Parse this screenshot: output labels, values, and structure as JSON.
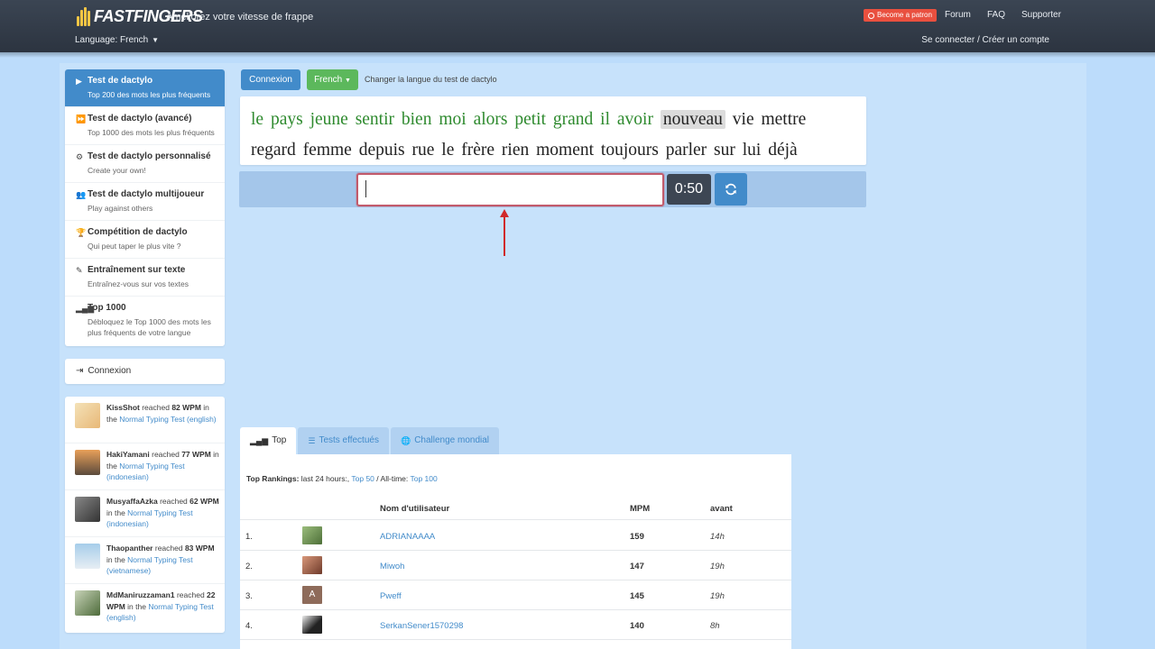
{
  "header": {
    "logo_text": "FASTFINGERS",
    "logo_prefix": "10",
    "tagline": "Améliorez votre vitesse de frappe",
    "patron_label": "Become a patron",
    "nav": {
      "forum": "Forum",
      "faq": "FAQ",
      "support": "Supporter"
    },
    "language_label": "Language: French",
    "login_link": "Se connecter / Créer un compte"
  },
  "sidebar": {
    "items": [
      {
        "title": "Test de dactylo",
        "sub": "Top 200 des mots les plus fréquents",
        "icon": "play-icon"
      },
      {
        "title": "Test de dactylo (avancé)",
        "sub": "Top 1000 des mots les plus fréquents",
        "icon": "fast-forward-icon"
      },
      {
        "title": "Test de dactylo personnalisé",
        "sub": "Create your own!",
        "icon": "cogs-icon"
      },
      {
        "title": "Test de dactylo multijoueur",
        "sub": "Play against others",
        "icon": "users-icon"
      },
      {
        "title": "Compétition de dactylo",
        "sub": "Qui peut taper le plus vite ?",
        "icon": "trophy-icon"
      },
      {
        "title": "Entraînement sur texte",
        "sub": "Entraînez-vous sur vos textes",
        "icon": "edit-icon"
      },
      {
        "title": "Top 1000",
        "sub": "Débloquez le Top 1000 des mots les plus fréquents de votre langue",
        "icon": "signal-icon"
      }
    ],
    "login": "Connexion"
  },
  "activity": [
    {
      "user": "KissShot",
      "reached": "reached",
      "wpm": "82 WPM",
      "in": "in the",
      "test": "Normal Typing Test",
      "lang": "(english)"
    },
    {
      "user": "HakiYamani",
      "reached": "reached",
      "wpm": "77 WPM",
      "in": "in the",
      "test": "Normal Typing Test",
      "lang": "(indonesian)"
    },
    {
      "user": "MusyaffaAzka",
      "reached": "reached",
      "wpm": "62 WPM",
      "in": "in the",
      "test": "Normal Typing Test",
      "lang": "(indonesian)"
    },
    {
      "user": "Thaopanther",
      "reached": "reached",
      "wpm": "83 WPM",
      "in": "in the",
      "test": "Normal Typing Test",
      "lang": "(vietnamese)"
    },
    {
      "user": "MdManiruzzaman1",
      "reached": "reached",
      "wpm": "22 WPM",
      "in": "in the",
      "test": "Normal Typing Test",
      "lang": "(english)"
    }
  ],
  "controls": {
    "connexion": "Connexion",
    "language_button": "French",
    "change_language": "Changer la langue du test de dactylo"
  },
  "words": {
    "done": [
      "le",
      "pays",
      "jeune",
      "sentir",
      "bien",
      "moi",
      "alors",
      "petit",
      "grand",
      "il",
      "avoir"
    ],
    "current": "nouveau",
    "upcoming_line1": [
      "vie",
      "mettre"
    ],
    "line2": [
      "regard",
      "femme",
      "depuis",
      "rue",
      "le",
      "frère",
      "rien",
      "moment",
      "toujours",
      "parler",
      "sur",
      "lui",
      "déjà"
    ]
  },
  "typing": {
    "value": "",
    "timer": "0:50"
  },
  "tabs": {
    "top": "Top",
    "tests": "Tests effectués",
    "challenge": "Challenge mondial"
  },
  "rankings": {
    "label": "Top Rankings:",
    "last24": "last 24 hours:,",
    "top50": "Top 50",
    "alltime": "/ All-time:",
    "top100": "Top 100",
    "columns": {
      "user": "Nom d'utilisateur",
      "wpm": "MPM",
      "ago": "avant"
    },
    "rows": [
      {
        "rank": "1.",
        "user": "ADRIANAAAA",
        "wpm": "159",
        "ago": "14h",
        "avatar_color": "#6c8f52"
      },
      {
        "rank": "2.",
        "user": "Miwoh",
        "wpm": "147",
        "ago": "19h",
        "avatar_color": "#b06a52"
      },
      {
        "rank": "3.",
        "user": "Pweff",
        "wpm": "145",
        "ago": "19h",
        "avatar_color": "#8e6b5a",
        "avatar_letter": "A"
      },
      {
        "rank": "4.",
        "user": "SerkanSener1570298",
        "wpm": "140",
        "ago": "8h",
        "avatar_color": "#2a2a2a"
      }
    ]
  },
  "colors": {
    "accent": "#428bca",
    "success": "#5cb85c",
    "header": "#343d49",
    "word_done": "#2e8a2e"
  }
}
